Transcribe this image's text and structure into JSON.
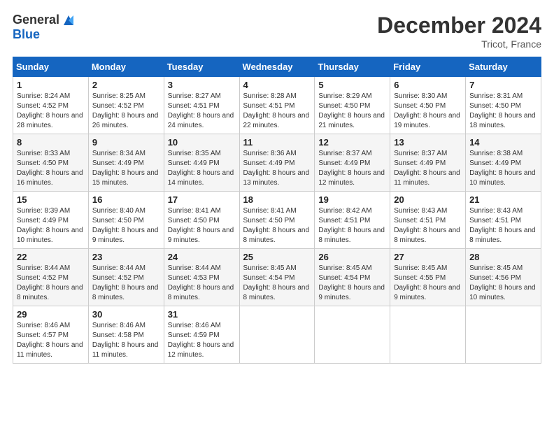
{
  "header": {
    "logo_general": "General",
    "logo_blue": "Blue",
    "month_title": "December 2024",
    "location": "Tricot, France"
  },
  "weekdays": [
    "Sunday",
    "Monday",
    "Tuesday",
    "Wednesday",
    "Thursday",
    "Friday",
    "Saturday"
  ],
  "weeks": [
    [
      {
        "day": "1",
        "sunrise": "8:24 AM",
        "sunset": "4:52 PM",
        "daylight": "8 hours and 28 minutes."
      },
      {
        "day": "2",
        "sunrise": "8:25 AM",
        "sunset": "4:52 PM",
        "daylight": "8 hours and 26 minutes."
      },
      {
        "day": "3",
        "sunrise": "8:27 AM",
        "sunset": "4:51 PM",
        "daylight": "8 hours and 24 minutes."
      },
      {
        "day": "4",
        "sunrise": "8:28 AM",
        "sunset": "4:51 PM",
        "daylight": "8 hours and 22 minutes."
      },
      {
        "day": "5",
        "sunrise": "8:29 AM",
        "sunset": "4:50 PM",
        "daylight": "8 hours and 21 minutes."
      },
      {
        "day": "6",
        "sunrise": "8:30 AM",
        "sunset": "4:50 PM",
        "daylight": "8 hours and 19 minutes."
      },
      {
        "day": "7",
        "sunrise": "8:31 AM",
        "sunset": "4:50 PM",
        "daylight": "8 hours and 18 minutes."
      }
    ],
    [
      {
        "day": "8",
        "sunrise": "8:33 AM",
        "sunset": "4:50 PM",
        "daylight": "8 hours and 16 minutes."
      },
      {
        "day": "9",
        "sunrise": "8:34 AM",
        "sunset": "4:49 PM",
        "daylight": "8 hours and 15 minutes."
      },
      {
        "day": "10",
        "sunrise": "8:35 AM",
        "sunset": "4:49 PM",
        "daylight": "8 hours and 14 minutes."
      },
      {
        "day": "11",
        "sunrise": "8:36 AM",
        "sunset": "4:49 PM",
        "daylight": "8 hours and 13 minutes."
      },
      {
        "day": "12",
        "sunrise": "8:37 AM",
        "sunset": "4:49 PM",
        "daylight": "8 hours and 12 minutes."
      },
      {
        "day": "13",
        "sunrise": "8:37 AM",
        "sunset": "4:49 PM",
        "daylight": "8 hours and 11 minutes."
      },
      {
        "day": "14",
        "sunrise": "8:38 AM",
        "sunset": "4:49 PM",
        "daylight": "8 hours and 10 minutes."
      }
    ],
    [
      {
        "day": "15",
        "sunrise": "8:39 AM",
        "sunset": "4:49 PM",
        "daylight": "8 hours and 10 minutes."
      },
      {
        "day": "16",
        "sunrise": "8:40 AM",
        "sunset": "4:50 PM",
        "daylight": "8 hours and 9 minutes."
      },
      {
        "day": "17",
        "sunrise": "8:41 AM",
        "sunset": "4:50 PM",
        "daylight": "8 hours and 9 minutes."
      },
      {
        "day": "18",
        "sunrise": "8:41 AM",
        "sunset": "4:50 PM",
        "daylight": "8 hours and 8 minutes."
      },
      {
        "day": "19",
        "sunrise": "8:42 AM",
        "sunset": "4:51 PM",
        "daylight": "8 hours and 8 minutes."
      },
      {
        "day": "20",
        "sunrise": "8:43 AM",
        "sunset": "4:51 PM",
        "daylight": "8 hours and 8 minutes."
      },
      {
        "day": "21",
        "sunrise": "8:43 AM",
        "sunset": "4:51 PM",
        "daylight": "8 hours and 8 minutes."
      }
    ],
    [
      {
        "day": "22",
        "sunrise": "8:44 AM",
        "sunset": "4:52 PM",
        "daylight": "8 hours and 8 minutes."
      },
      {
        "day": "23",
        "sunrise": "8:44 AM",
        "sunset": "4:52 PM",
        "daylight": "8 hours and 8 minutes."
      },
      {
        "day": "24",
        "sunrise": "8:44 AM",
        "sunset": "4:53 PM",
        "daylight": "8 hours and 8 minutes."
      },
      {
        "day": "25",
        "sunrise": "8:45 AM",
        "sunset": "4:54 PM",
        "daylight": "8 hours and 8 minutes."
      },
      {
        "day": "26",
        "sunrise": "8:45 AM",
        "sunset": "4:54 PM",
        "daylight": "8 hours and 9 minutes."
      },
      {
        "day": "27",
        "sunrise": "8:45 AM",
        "sunset": "4:55 PM",
        "daylight": "8 hours and 9 minutes."
      },
      {
        "day": "28",
        "sunrise": "8:45 AM",
        "sunset": "4:56 PM",
        "daylight": "8 hours and 10 minutes."
      }
    ],
    [
      {
        "day": "29",
        "sunrise": "8:46 AM",
        "sunset": "4:57 PM",
        "daylight": "8 hours and 11 minutes."
      },
      {
        "day": "30",
        "sunrise": "8:46 AM",
        "sunset": "4:58 PM",
        "daylight": "8 hours and 11 minutes."
      },
      {
        "day": "31",
        "sunrise": "8:46 AM",
        "sunset": "4:59 PM",
        "daylight": "8 hours and 12 minutes."
      },
      null,
      null,
      null,
      null
    ]
  ]
}
